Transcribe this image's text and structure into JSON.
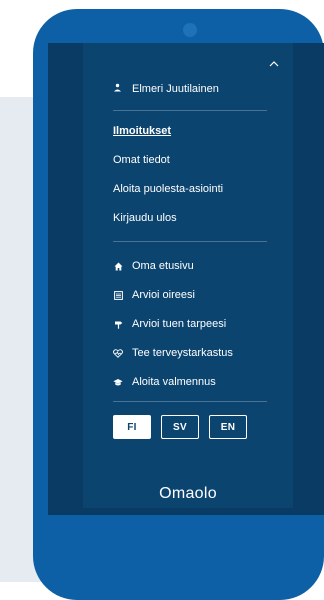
{
  "user": {
    "name": "Elmeri Juutilainen",
    "icon": "user-icon"
  },
  "account_links": [
    {
      "label": "Ilmoitukset",
      "active": true
    },
    {
      "label": "Omat tiedot"
    },
    {
      "label": "Aloita puolesta-asiointi"
    },
    {
      "label": "Kirjaudu ulos"
    }
  ],
  "nav": [
    {
      "label": "Oma etusivu",
      "icon": "home-icon"
    },
    {
      "label": "Arvioi oireesi",
      "icon": "list-icon"
    },
    {
      "label": "Arvioi tuen tarpeesi",
      "icon": "signpost-icon"
    },
    {
      "label": "Tee terveystarkastus",
      "icon": "heart-pulse-icon"
    },
    {
      "label": "Aloita valmennus",
      "icon": "graduation-cap-icon"
    }
  ],
  "languages": [
    {
      "code": "FI",
      "active": true
    },
    {
      "code": "SV"
    },
    {
      "code": "EN"
    }
  ],
  "logo": "Omaolo",
  "colors": {
    "phone": "#0d60a5",
    "menu": "#0c4470",
    "screen": "#0a3b64",
    "background_panel": "#e6ebf1"
  }
}
